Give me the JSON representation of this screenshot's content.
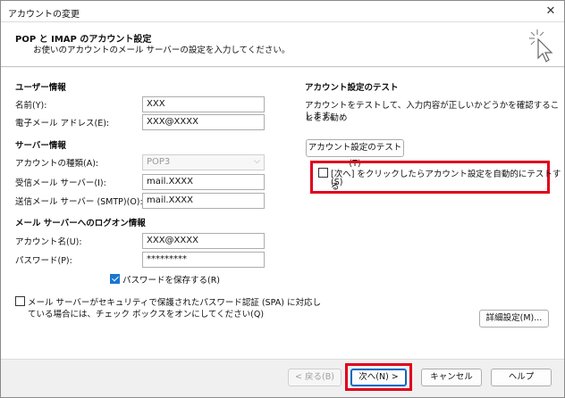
{
  "window": {
    "title": "アカウントの変更",
    "close_glyph": "✕"
  },
  "header": {
    "title": "POP と IMAP のアカウント設定",
    "subtitle": "お使いのアカウントのメール サーバーの設定を入力してください。"
  },
  "user_info": {
    "heading": "ユーザー情報",
    "name_label": "名前(Y):",
    "name_value": "XXX",
    "email_label": "電子メール アドレス(E):",
    "email_value": "XXX@XXXX"
  },
  "server_info": {
    "heading": "サーバー情報",
    "account_type_label": "アカウントの種類(A):",
    "account_type_value": "POP3",
    "incoming_label": "受信メール サーバー(I):",
    "incoming_value": "mail.XXXX",
    "outgoing_label": "送信メール サーバー (SMTP)(O):",
    "outgoing_value": "mail.XXXX"
  },
  "logon_info": {
    "heading": "メール サーバーへのログオン情報",
    "account_name_label": "アカウント名(U):",
    "account_name_value": "XXX@XXXX",
    "password_label": "パスワード(P):",
    "password_value": "*********",
    "remember_password_label": "パスワードを保存する(R)",
    "remember_password_checked": true,
    "spa_label_line1": "メール サーバーがセキュリティで保護されたパスワード認証 (SPA) に対応し",
    "spa_label_line2": "ている場合には、チェック ボックスをオンにしてください(Q)",
    "spa_checked": false
  },
  "test": {
    "heading": "アカウント設定のテスト",
    "desc_line1": "アカウントをテストして、入力内容が正しいかどうかを確認することをお勧め",
    "desc_line2": "します。",
    "test_button": "アカウント設定のテスト(T)",
    "auto_test_line1": "[次へ] をクリックしたらアカウント設定を自動的にテストする",
    "auto_test_line2": "(S)",
    "auto_test_checked": false
  },
  "buttons": {
    "advanced": "詳細設定(M)...",
    "back": "< 戻る(B)",
    "next": "次へ(N) >",
    "cancel": "キャンセル",
    "help": "ヘルプ"
  },
  "colors": {
    "highlight": "#e0001b",
    "accent": "#0067c0"
  },
  "icons": {
    "header": "sparkle-cursor-icon",
    "dropdown": "chevron-down-icon"
  }
}
